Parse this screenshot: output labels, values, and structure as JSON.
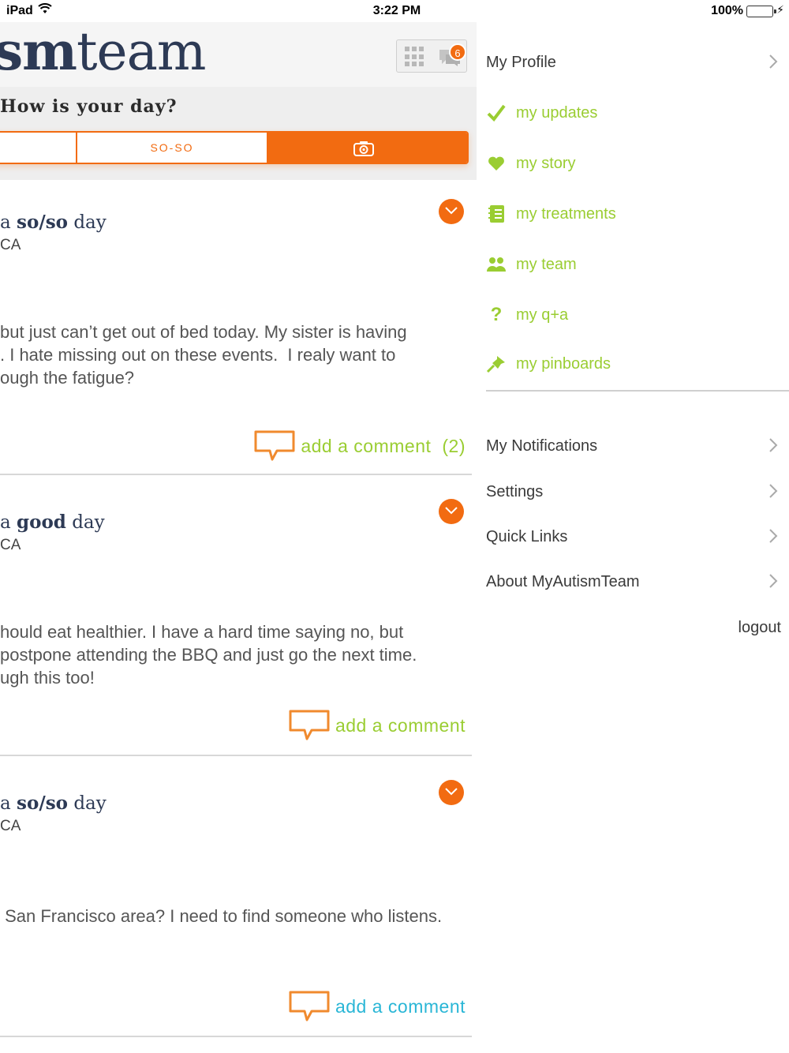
{
  "status_bar": {
    "device": "iPad",
    "time": "3:22 PM",
    "battery": "100%"
  },
  "header": {
    "logo_bold": "sm",
    "logo_light": "team",
    "notification_count": "6"
  },
  "day_prompt": {
    "question": "How is your day?",
    "mood_option": "SO-SO"
  },
  "posts": [
    {
      "title_prefix": "a ",
      "mood": "so/so",
      "title_suffix": " day",
      "location": "CA",
      "body": "but just can’t get out of bed today. My sister is having\n. I hate missing out on these events.  I realy want to\nough the fatigue?",
      "comment_label": "add a comment",
      "comment_count": "(2)"
    },
    {
      "title_prefix": "a ",
      "mood": "good",
      "title_suffix": " day",
      "location": "CA",
      "body": "hould eat healthier. I have a hard time saying no, but\npostpone attending the BBQ and just go the next time.\nugh this too!",
      "comment_label": "add a comment"
    },
    {
      "title_prefix": "a ",
      "mood": "so/so",
      "title_suffix": " day",
      "location": "CA",
      "body": " San Francisco area? I need to find someone who listens.",
      "comment_label": "add a comment"
    }
  ],
  "menu": {
    "profile": "My Profile",
    "items": [
      {
        "label": "my updates",
        "icon": "check-icon"
      },
      {
        "label": "my story",
        "icon": "heart-icon"
      },
      {
        "label": "my treatments",
        "icon": "notebook-icon"
      },
      {
        "label": "my team",
        "icon": "people-icon"
      },
      {
        "label": "my q+a",
        "icon": "question-icon"
      },
      {
        "label": "my pinboards",
        "icon": "pin-icon"
      }
    ],
    "notifications": "My Notifications",
    "settings": "Settings",
    "quick_links": "Quick Links",
    "about": "About MyAutismTeam",
    "logout": "logout"
  },
  "colors": {
    "accent_orange": "#f26b11",
    "accent_green": "#9acd32",
    "accent_teal": "#29b6d6",
    "brand_navy": "#2d3a55"
  }
}
